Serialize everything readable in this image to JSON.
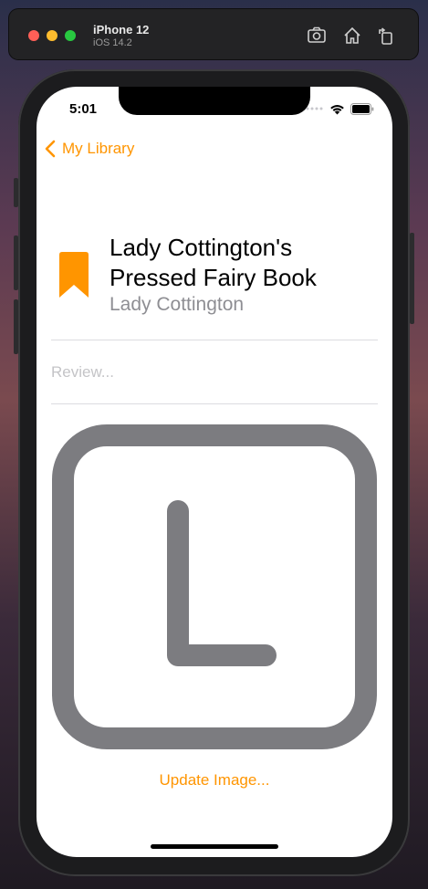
{
  "simulator": {
    "device_name": "iPhone 12",
    "os_version": "iOS 14.2"
  },
  "status_bar": {
    "time": "5:01"
  },
  "nav": {
    "back_label": "My Library"
  },
  "book": {
    "title": "Lady Cottington's Pressed Fairy Book",
    "author": "Lady Cottington",
    "review_placeholder": "Review...",
    "cover_letter": "L"
  },
  "actions": {
    "update_image_label": "Update Image..."
  },
  "colors": {
    "accent": "#ff9500",
    "cover_gray": "#7c7c80",
    "secondary_text": "#8e8e93"
  }
}
